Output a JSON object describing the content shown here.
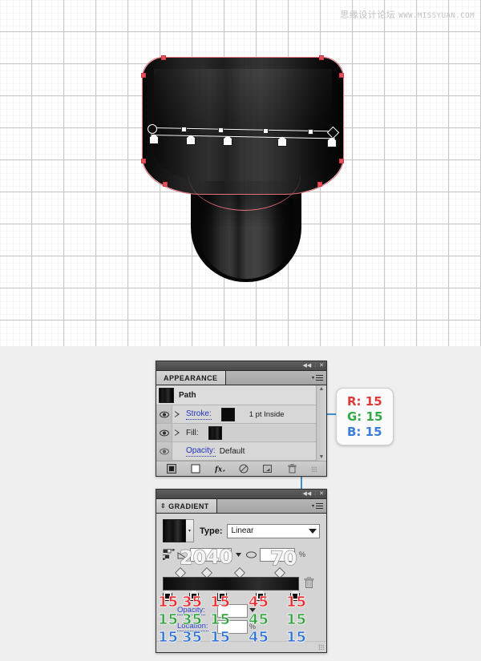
{
  "watermark": {
    "cn": "思缘设计论坛",
    "en": "WWW.MISSYUAN.COM"
  },
  "artwork": {
    "name": "vector-bottle-shape",
    "gradient_annotator": {
      "stop_count": 5,
      "midpoint_count": 4
    }
  },
  "appearance_panel": {
    "tab_label": "APPEARANCE",
    "title_collapse": "◀◀",
    "title_close": "✕",
    "object_row": {
      "label": "Path"
    },
    "rows": [
      {
        "label": "Stroke:",
        "value": "1 pt  Inside",
        "has_swatch": true,
        "visible": true
      },
      {
        "label": "Fill:",
        "value": "",
        "has_swatch": true,
        "visible": true
      },
      {
        "label": "Opacity:",
        "value": "Default",
        "has_swatch": false,
        "visible": true
      }
    ],
    "footer_icons": [
      "add-new-stroke-icon",
      "add-new-fill-icon",
      "add-new-effect-icon",
      "clear-appearance-icon",
      "duplicate-item-icon",
      "delete-item-icon"
    ]
  },
  "gradient_panel": {
    "tab_label": "GRADIENT",
    "title_collapse": "◀◀",
    "title_close": "✕",
    "type_label": "Type:",
    "type_value": "Linear",
    "angle_value": "",
    "aspect_value": "",
    "aspect_unit": "%",
    "opacity_label": "Opacity:",
    "opacity_value": "",
    "location_label": "Location:",
    "location_value": "",
    "location_unit": "%",
    "stops": [
      {
        "location": 0,
        "r": 15,
        "g": 15,
        "b": 15
      },
      {
        "location": 20,
        "r": 35,
        "g": 35,
        "b": 35
      },
      {
        "location": 40,
        "r": 15,
        "g": 15,
        "b": 15
      },
      {
        "location": 70,
        "r": 45,
        "g": 45,
        "b": 45
      },
      {
        "location": 100,
        "r": 15,
        "g": 15,
        "b": 15
      }
    ]
  },
  "overlay_annotations": {
    "locations": [
      "20",
      "40",
      "70"
    ],
    "rgb_rows": {
      "r": [
        "15",
        "35",
        "15",
        "45",
        "15"
      ],
      "g": [
        "15",
        "35",
        "15",
        "45",
        "15"
      ],
      "b": [
        "15",
        "35",
        "15",
        "45",
        "15"
      ]
    }
  },
  "rgb_callout": {
    "r_text": "R: 15",
    "g_text": "G: 15",
    "b_text": "B: 15",
    "r_color": "#e03a3a",
    "g_color": "#35a846",
    "b_color": "#3b7ddb"
  },
  "colors": {
    "callout_line": "#3f8fd0",
    "grid_line": "#c9c9c9",
    "panel_bg": "#d4d4d4",
    "selection_outline": "#e8505e"
  }
}
